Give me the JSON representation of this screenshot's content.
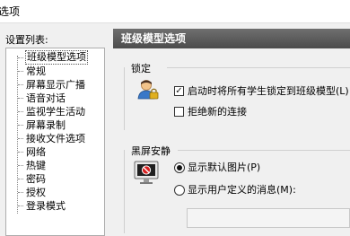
{
  "window": {
    "title": "选项"
  },
  "settings_list_label": "设置列表:",
  "tree_items": [
    {
      "label": "班级模型选项",
      "selected": true
    },
    {
      "label": "常规",
      "selected": false
    },
    {
      "label": "屏幕显示广播",
      "selected": false
    },
    {
      "label": "语音对话",
      "selected": false
    },
    {
      "label": "监视学生活动",
      "selected": false
    },
    {
      "label": "屏幕录制",
      "selected": false
    },
    {
      "label": "接收文件选项",
      "selected": false
    },
    {
      "label": "网络",
      "selected": false
    },
    {
      "label": "热键",
      "selected": false
    },
    {
      "label": "密码",
      "selected": false
    },
    {
      "label": "授权",
      "selected": false
    },
    {
      "label": "登录模式",
      "selected": false
    }
  ],
  "panel": {
    "title": "班级模型选项",
    "lock_group": {
      "title": "锁定",
      "icon": "user-lock-icon",
      "lock_students": {
        "label": "启动时将所有学生锁定到班级模型(L)",
        "checked": true
      },
      "reject_new": {
        "label": "拒绝新的连接",
        "checked": false
      }
    },
    "blackscreen_group": {
      "title": "黑屏安静",
      "icon": "blank-monitor-icon",
      "options": [
        {
          "label": "显示默认图片(P)",
          "checked": true
        },
        {
          "label": "显示用户定义的消息(M):",
          "checked": false
        }
      ],
      "message_value": ""
    }
  },
  "colors": {
    "header_bg": "#5a5a5a",
    "header_text": "#ffffff",
    "window_bg": "#f0f0f0"
  }
}
